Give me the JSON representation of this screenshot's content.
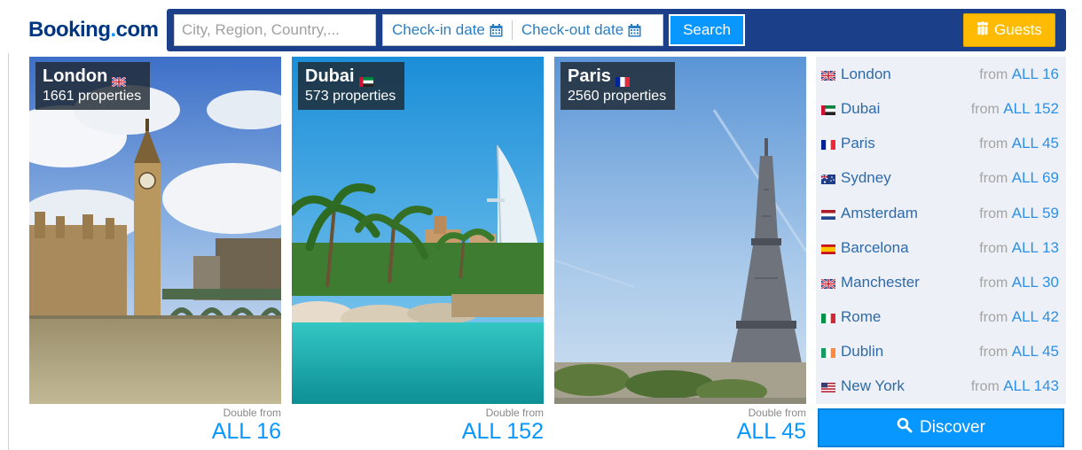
{
  "header": {
    "logo": {
      "brand": "Booking",
      "dot": ".",
      "tld": "com"
    },
    "search": {
      "city_placeholder": "City, Region, Country,...",
      "checkin_label": "Check-in date",
      "checkout_label": "Check-out date",
      "search_label": "Search",
      "guests_label": "Guests"
    }
  },
  "cards": [
    {
      "city": "London",
      "flag": "uk",
      "properties": "1661 properties",
      "price_caption": "Double from",
      "price": "ALL 16"
    },
    {
      "city": "Dubai",
      "flag": "uae",
      "properties": "573 properties",
      "price_caption": "Double from",
      "price": "ALL 152"
    },
    {
      "city": "Paris",
      "flag": "fr",
      "properties": "2560 properties",
      "price_caption": "Double from",
      "price": "ALL 45"
    }
  ],
  "destinations": [
    {
      "name": "London",
      "flag": "uk",
      "from": "from",
      "price": "ALL 16"
    },
    {
      "name": "Dubai",
      "flag": "uae",
      "from": "from",
      "price": "ALL 152"
    },
    {
      "name": "Paris",
      "flag": "fr",
      "from": "from",
      "price": "ALL 45"
    },
    {
      "name": "Sydney",
      "flag": "au",
      "from": "from",
      "price": "ALL 69"
    },
    {
      "name": "Amsterdam",
      "flag": "nl",
      "from": "from",
      "price": "ALL 59"
    },
    {
      "name": "Barcelona",
      "flag": "es",
      "from": "from",
      "price": "ALL 13"
    },
    {
      "name": "Manchester",
      "flag": "uk",
      "from": "from",
      "price": "ALL 30"
    },
    {
      "name": "Rome",
      "flag": "it",
      "from": "from",
      "price": "ALL 42"
    },
    {
      "name": "Dublin",
      "flag": "ie",
      "from": "from",
      "price": "ALL 45"
    },
    {
      "name": "New York",
      "flag": "us",
      "from": "from",
      "price": "ALL 143"
    }
  ],
  "discover_label": "Discover",
  "colors": {
    "brand_navy": "#003580",
    "search_bar": "#1c3f8a",
    "accent_blue": "#0896ff",
    "guests_yellow": "#febb02"
  }
}
